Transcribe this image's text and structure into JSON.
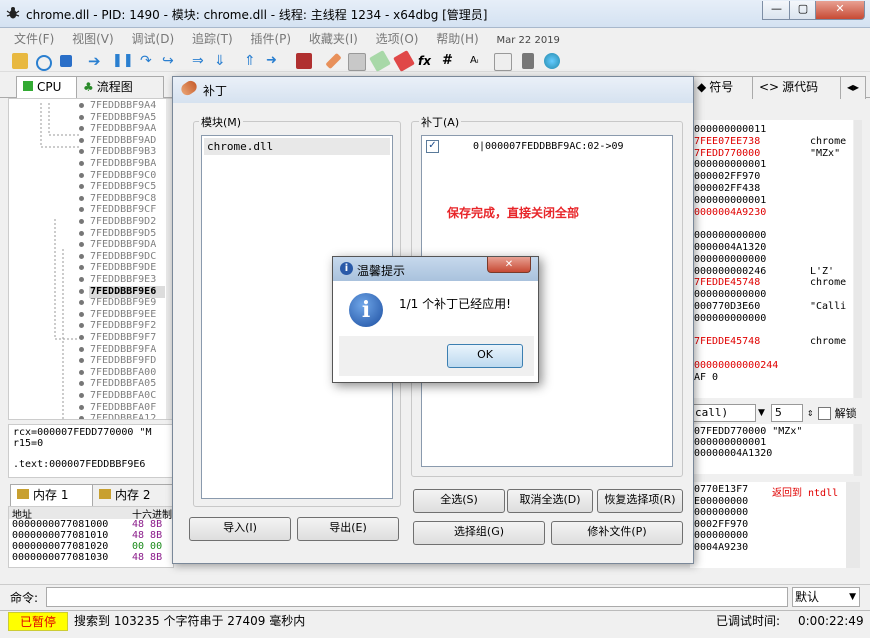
{
  "window": {
    "title": "chrome.dll - PID: 1490 - 模块: chrome.dll - 线程: 主线程 1234 - x64dbg [管理员]"
  },
  "menu": {
    "items": [
      "文件(F)",
      "视图(V)",
      "调试(D)",
      "追踪(T)",
      "插件(P)",
      "收藏夹(I)",
      "选项(O)",
      "帮助(H)"
    ],
    "date": "Mar 22 2019"
  },
  "tabs": {
    "cpu": "CPU",
    "graph": "流程图",
    "symbols": "符号",
    "source": "源代码"
  },
  "disasm": {
    "addresses": [
      "7FEDDBBF9A4",
      "7FEDDBBF9A5",
      "7FEDDBBF9AA",
      "7FEDDBBF9AD",
      "7FEDDBBF9B3",
      "7FEDDBBF9BA",
      "7FEDDBBF9C0",
      "7FEDDBBF9C5",
      "7FEDDBBF9C8",
      "7FEDDBBF9CF",
      "7FEDDBBF9D2",
      "7FEDDBBF9D5",
      "7FEDDBBF9DA",
      "7FEDDBBF9DC",
      "7FEDDBBF9DE",
      "7FEDDBBF9E3",
      "7FEDDBBF9E6",
      "7FEDDBBF9E9",
      "7FEDDBBF9EE",
      "7FEDDBBF9F2",
      "7FEDDBBF9F7",
      "7FEDDBBF9FA",
      "7FEDDBBF9FD",
      "7FEDDBBFA00",
      "7FEDDBBFA05",
      "7FEDDBBFA0C",
      "7FEDDBBFA0F",
      "7FEDDBBFA12"
    ],
    "selected_index": 16
  },
  "info": {
    "line1": "rcx=000007FEDD770000 \"M",
    "line2": "r15=0",
    "line3": ".text:000007FEDDBBF9E6"
  },
  "dump": {
    "tab1": "内存 1",
    "tab2": "内存 2",
    "col_addr": "地址",
    "col_hex": "十六进制",
    "rows": [
      {
        "addr": "0000000077081000",
        "hex": "48 8B"
      },
      {
        "addr": "0000000077081010",
        "hex": "48 8B"
      },
      {
        "addr": "0000000077081020",
        "hex": "00 00"
      },
      {
        "addr": "0000000077081030",
        "hex": "48 8B"
      }
    ]
  },
  "registers": [
    {
      "v": "000000000011",
      "c": "",
      "red": false
    },
    {
      "v": "7FEE07EE738",
      "c": "chrome",
      "red": true
    },
    {
      "v": "7FEDD770000",
      "c": "\"MZx\"",
      "red": true
    },
    {
      "v": "000000000001",
      "c": "",
      "red": false
    },
    {
      "v": "000002FF970",
      "c": "",
      "red": false
    },
    {
      "v": "000002FF438",
      "c": "",
      "red": false
    },
    {
      "v": "000000000001",
      "c": "",
      "red": false
    },
    {
      "v": "0000004A9230",
      "c": "",
      "red": true
    },
    {
      "v": "",
      "c": "",
      "red": false
    },
    {
      "v": "000000000000",
      "c": "",
      "red": false
    },
    {
      "v": "0000004A1320",
      "c": "",
      "red": false
    },
    {
      "v": "000000000000",
      "c": "",
      "red": false
    },
    {
      "v": "000000000246",
      "c": "L'Z'",
      "red": false
    },
    {
      "v": "7FEDDE45748",
      "c": "chrome",
      "red": true
    },
    {
      "v": "000000000000",
      "c": "",
      "red": false
    },
    {
      "v": "000770D3E60",
      "c": "\"Calli",
      "red": false
    },
    {
      "v": "000000000000",
      "c": "",
      "red": false
    },
    {
      "v": "",
      "c": "",
      "red": false
    },
    {
      "v": "7FEDDE45748",
      "c": "chrome",
      "red": true
    },
    {
      "v": "",
      "c": "",
      "red": false
    },
    {
      "v": "00000000000244",
      "c": "",
      "red": true
    },
    {
      "v": "AF 0",
      "c": "",
      "red": false
    }
  ],
  "callbar": {
    "label": "call)",
    "count": "5",
    "unlock": "解锁"
  },
  "stack": [
    "07FEDD770000 \"MZx\"",
    "000000000001",
    "00000004A1320"
  ],
  "stack2": [
    {
      "v": "0770E13F7",
      "c": "返回到 ntdll",
      "red": true
    },
    {
      "v": "E00000000",
      "c": "",
      "red": false
    },
    {
      "v": "000000000",
      "c": "",
      "red": false
    },
    {
      "v": "0002FF970",
      "c": "",
      "red": false
    },
    {
      "v": "000000000",
      "c": "",
      "red": false
    },
    {
      "v": "0004A9230",
      "c": "",
      "red": false
    }
  ],
  "command": {
    "label": "命令:",
    "default": "默认"
  },
  "status": {
    "paused": "已暂停",
    "message": "搜索到 103235 个字符串于 27409 毫秒内",
    "timer_label": "已调试时间:",
    "timer": "0:00:22:49"
  },
  "patch_dialog": {
    "title": "补丁",
    "modules_label": "模块(M)",
    "module_item": "chrome.dll",
    "patches_label": "补丁(A)",
    "patch_item": "0|000007FEDDBBF9AC:02->09",
    "note": "保存完成，直接关闭全部",
    "note_color": "#e8262a",
    "import": "导入(I)",
    "export": "导出(E)",
    "select_all": "全选(S)",
    "deselect_all": "取消全选(D)",
    "restore": "恢复选择项(R)",
    "select_group": "选择组(G)",
    "patch_file": "修补文件(P)"
  },
  "message_box": {
    "title": "温馨提示",
    "text": "1/1 个补丁已经应用!",
    "ok": "OK"
  }
}
